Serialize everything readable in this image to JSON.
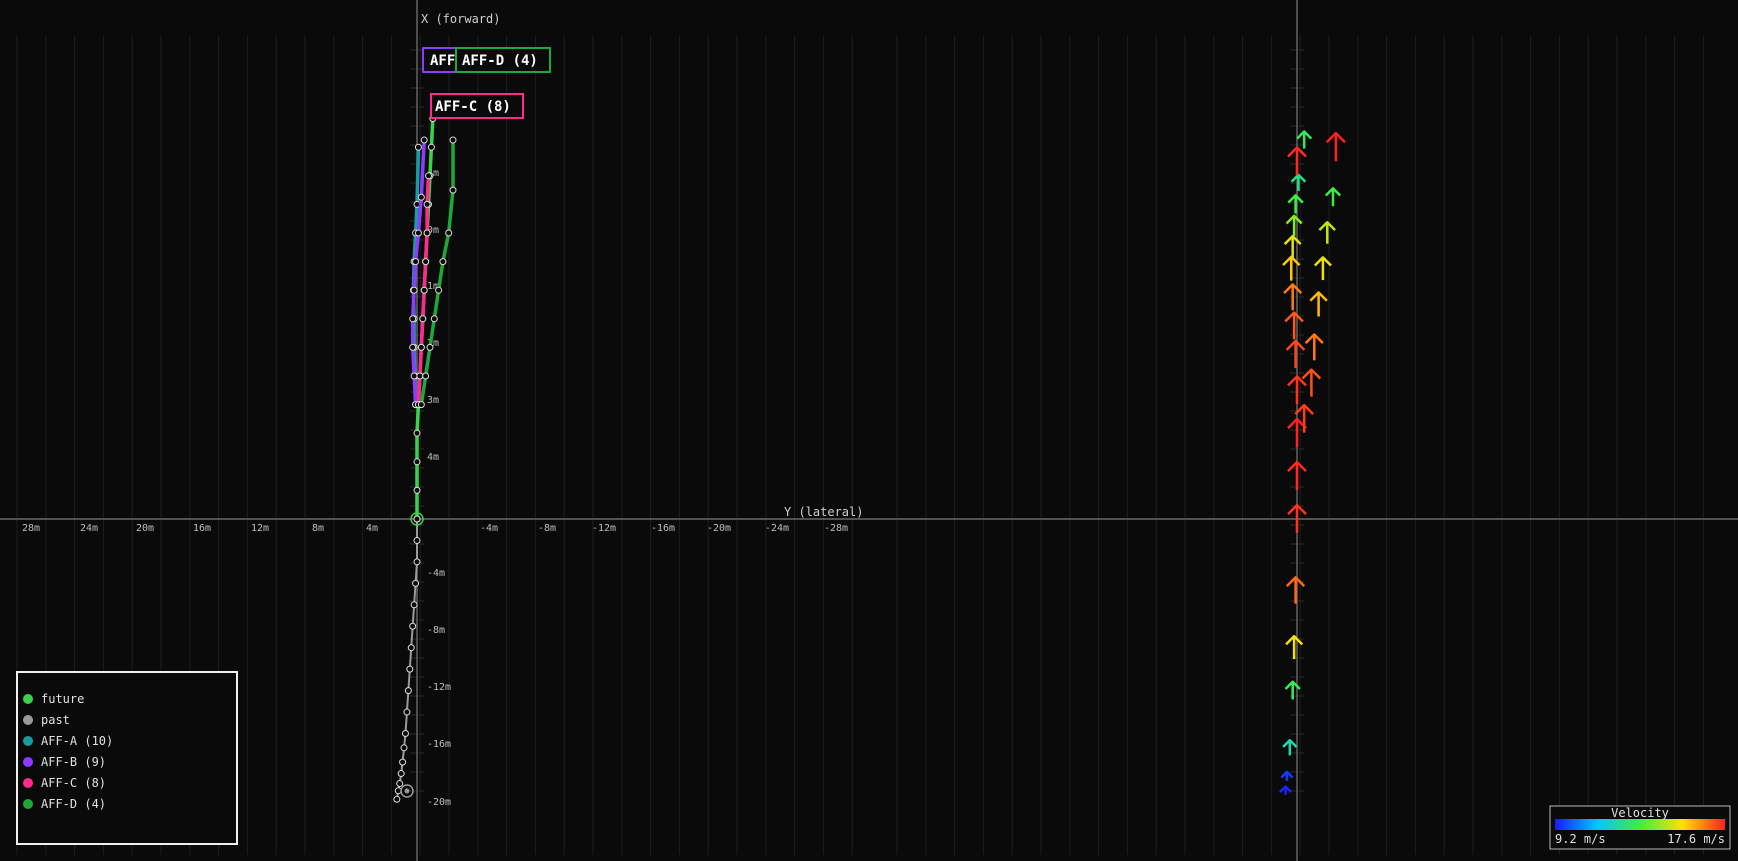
{
  "left_panel": {
    "x_axis_label": "X (forward)",
    "y_axis_label": "Y (lateral)",
    "lateral_ticks": [
      "28m",
      "24m",
      "20m",
      "16m",
      "12m",
      "8m",
      "4m",
      "-4m",
      "-8m",
      "-12m",
      "-16m",
      "-20m",
      "-24m",
      "-28m"
    ],
    "forward_ticks": [
      "4m",
      "0m",
      "1m",
      "2m",
      "3m",
      "4m",
      "-4m",
      "-8m",
      "-12m",
      "-16m",
      "-20m"
    ],
    "tags": [
      {
        "label": "AFF",
        "color": "#8c3cff"
      },
      {
        "label": "AFF-D (4)",
        "color": "#1fa83a"
      },
      {
        "label": "AFF-C (8)",
        "color": "#ff2a8c"
      }
    ],
    "legend": [
      {
        "label": "future",
        "color": "#3cd14a"
      },
      {
        "label": "past",
        "color": "#9a9a9a"
      },
      {
        "label": "AFF-A (10)",
        "color": "#1a9ba0"
      },
      {
        "label": "AFF-B (9)",
        "color": "#8c3cff"
      },
      {
        "label": "AFF-C (8)",
        "color": "#ff2a8c"
      },
      {
        "label": "AFF-D (4)",
        "color": "#1fa83a"
      }
    ]
  },
  "right_panel": {
    "colorbar": {
      "title": "Velocity",
      "min_label": "9.2 m/s",
      "max_label": "17.6 m/s",
      "min": 9.2,
      "max": 17.6
    }
  },
  "chart_data": [
    {
      "type": "line",
      "title": "",
      "xlabel": "Y (lateral)",
      "ylabel": "X (forward)",
      "series": [
        {
          "name": "past",
          "color": "#9a9a9a",
          "lateral": [
            0,
            0,
            0,
            0.1,
            0.2,
            0.3,
            0.4,
            0.5,
            0.6,
            0.7,
            0.8,
            0.9,
            1.0,
            1.1,
            1.2,
            1.3,
            1.4
          ],
          "forward": [
            0,
            -1.5,
            -3,
            -4.5,
            -6,
            -7.5,
            -9,
            -10.5,
            -12,
            -13.5,
            -15,
            -16,
            -17,
            -17.8,
            -18.5,
            -19,
            -19.6
          ]
        },
        {
          "name": "future",
          "color": "#3cd14a",
          "lateral": [
            0,
            0,
            0,
            0,
            -0.1,
            -0.2,
            -0.3,
            -0.4,
            -0.5,
            -0.6,
            -0.7,
            -0.8,
            -0.9,
            -1.0,
            -1.1
          ],
          "forward": [
            0,
            2,
            4,
            6,
            8,
            10,
            12,
            14,
            16,
            18,
            20,
            22,
            24,
            26,
            28
          ]
        },
        {
          "name": "AFF-A (10)",
          "color": "#1a9ba0",
          "lateral": [
            0.1,
            0.15,
            0.2,
            0.2,
            0.25,
            0.2,
            0.1,
            0.0,
            -0.1
          ],
          "forward": [
            8,
            10,
            12,
            14,
            16,
            18,
            20,
            22,
            26
          ]
        },
        {
          "name": "AFF-B (9)",
          "color": "#8c3cff",
          "lateral": [
            0.1,
            0.2,
            0.3,
            0.3,
            0.2,
            0.1,
            -0.1,
            -0.3,
            -0.5
          ],
          "forward": [
            8,
            10,
            12,
            14,
            16,
            18,
            20,
            22.5,
            26.5
          ]
        },
        {
          "name": "AFF-C (8)",
          "color": "#ff2a8c",
          "lateral": [
            -0.1,
            -0.2,
            -0.3,
            -0.4,
            -0.5,
            -0.6,
            -0.7,
            -0.7,
            -0.8
          ],
          "forward": [
            8,
            10,
            12,
            14,
            16,
            18,
            20,
            22,
            24
          ]
        },
        {
          "name": "AFF-D (4)",
          "color": "#1fa83a",
          "lateral": [
            -0.3,
            -0.6,
            -0.9,
            -1.2,
            -1.5,
            -1.8,
            -2.2,
            -2.5,
            -2.5
          ],
          "forward": [
            8,
            10,
            12,
            14,
            16,
            18,
            20,
            23,
            26.5
          ]
        }
      ]
    },
    {
      "type": "scatter",
      "title": "",
      "xlabel": "",
      "ylabel": "",
      "series": [
        {
          "name": "Velocity",
          "forward": [
            -19,
            -18,
            -16,
            -12,
            -9,
            -5,
            0,
            3,
            6,
            9,
            11.5,
            13.5,
            15.5,
            17.5,
            19,
            20.5,
            22,
            23.5,
            25,
            26.5
          ],
          "lateral": [
            0.8,
            0.7,
            0.5,
            0.3,
            0.2,
            0.1,
            0.0,
            0.0,
            0.0,
            0.0,
            0.1,
            0.2,
            0.3,
            0.4,
            0.3,
            0.2,
            0.1,
            -0.1,
            0.0,
            -0.5
          ],
          "velocity": [
            9.3,
            9.6,
            12.2,
            13.2,
            15.4,
            16.8,
            17.4,
            17.5,
            17.6,
            17.4,
            17.2,
            17.0,
            16.6,
            15.8,
            15.2,
            14.2,
            13.4,
            12.6,
            17.5,
            13.0
          ]
        },
        {
          "name": "Velocity",
          "forward": [
            7,
            9.5,
            12,
            15,
            17.5,
            20,
            22.5,
            26
          ],
          "lateral": [
            -0.5,
            -1.0,
            -1.2,
            -1.5,
            -1.8,
            -2.1,
            -2.5,
            -2.7
          ],
          "velocity": [
            17.3,
            17.1,
            16.6,
            15.9,
            15.3,
            14.8,
            13.3,
            17.6
          ]
        }
      ]
    }
  ]
}
